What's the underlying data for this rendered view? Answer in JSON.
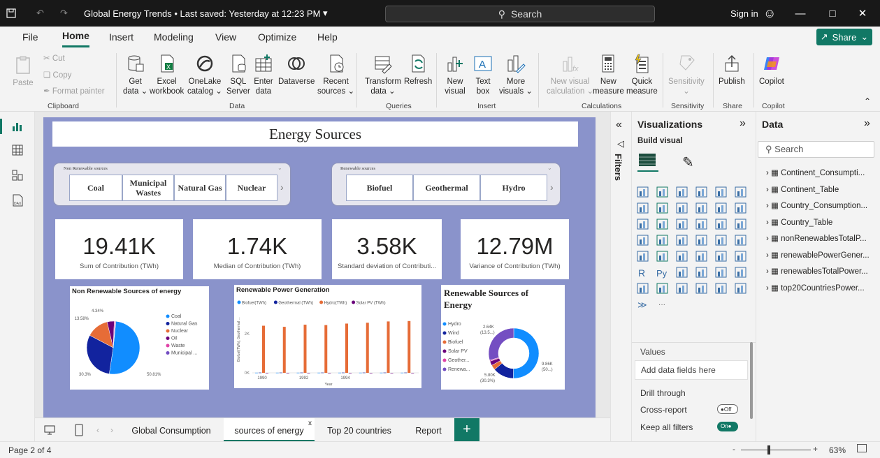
{
  "titlebar": {
    "title": "Global Energy Trends • Last saved: Yesterday at 12:23 PM",
    "search": "Search",
    "sign_in": "Sign in"
  },
  "menu": {
    "items": [
      "File",
      "Home",
      "Insert",
      "Modeling",
      "View",
      "Optimize",
      "Help"
    ],
    "share": "Share"
  },
  "ribbon": {
    "clipboard": {
      "paste": "Paste",
      "cut": "Cut",
      "copy": "Copy",
      "format_painter": "Format painter",
      "group": "Clipboard"
    },
    "data": {
      "get_data": [
        "Get",
        "data"
      ],
      "excel": [
        "Excel",
        "workbook"
      ],
      "onelake": [
        "OneLake",
        "catalog"
      ],
      "sql": [
        "SQL",
        "Server"
      ],
      "enter": [
        "Enter",
        "data"
      ],
      "dataverse": "Dataverse",
      "recent": [
        "Recent",
        "sources"
      ],
      "group": "Data"
    },
    "queries": {
      "transform": [
        "Transform",
        "data"
      ],
      "refresh": "Refresh",
      "group": "Queries"
    },
    "insert": {
      "new_visual": [
        "New",
        "visual"
      ],
      "text_box": [
        "Text",
        "box"
      ],
      "more_visuals": [
        "More",
        "visuals"
      ],
      "group": "Insert"
    },
    "calculations": {
      "new_visual_calc": [
        "New visual",
        "calculation"
      ],
      "new_measure": [
        "New",
        "measure"
      ],
      "quick_measure": [
        "Quick",
        "measure"
      ],
      "group": "Calculations"
    },
    "sensitivity": {
      "label": "Sensitivity",
      "group": "Sensitivity"
    },
    "share": {
      "publish": "Publish",
      "group": "Share"
    },
    "copilot": {
      "label": "Copilot",
      "group": "Copilot"
    }
  },
  "report": {
    "title": "Energy Sources",
    "nonrenewable_slicer": {
      "header": "Non Renewable sources",
      "items": [
        "Coal",
        "Municipal Wastes",
        "Natural Gas",
        "Nuclear"
      ]
    },
    "renewable_slicer": {
      "header": "Renewable sources",
      "items": [
        "Biofuel",
        "Geothermal",
        "Hydro"
      ]
    },
    "kpis": [
      {
        "value": "19.41K",
        "label": "Sum of Contribution (TWh)"
      },
      {
        "value": "1.74K",
        "label": "Median of Contribution (TWh)"
      },
      {
        "value": "3.58K",
        "label": "Standard deviation of Contributi..."
      },
      {
        "value": "12.79M",
        "label": "Variance of Contribution (TWh)"
      }
    ]
  },
  "chart_data": [
    {
      "type": "pie",
      "title": "Non Renewable Sources of energy",
      "labels": [
        "Coal",
        "Natural Gas",
        "Nuclear",
        "Oil",
        "Waste",
        "Municipal ..."
      ],
      "values": [
        50.81,
        30.3,
        13.58,
        4.34,
        0.6,
        0.37
      ],
      "data_labels": [
        "50.81%",
        "30.3%",
        "13.58%",
        "4.34%"
      ],
      "colors": [
        "#118dff",
        "#12239e",
        "#e66c37",
        "#6b007b",
        "#e044a7",
        "#744ec2"
      ]
    },
    {
      "type": "bar",
      "title": "Renewable Power Generation",
      "series": [
        {
          "name": "Biofuel(TWh)",
          "color": "#118dff",
          "values": [
            5,
            5,
            5,
            5,
            5,
            5,
            5,
            5
          ]
        },
        {
          "name": "Geothermal (TWh)",
          "color": "#12239e",
          "values": [
            10,
            10,
            10,
            10,
            10,
            10,
            10,
            10
          ]
        },
        {
          "name": "Hydro(TWh)",
          "color": "#e66c37",
          "values": [
            2200,
            2150,
            2250,
            2230,
            2300,
            2340,
            2400,
            2420
          ]
        },
        {
          "name": "Solar PV (TWh)",
          "color": "#6b007b",
          "values": [
            0,
            0,
            0,
            0,
            0,
            0,
            0,
            0
          ]
        }
      ],
      "x": [
        1990,
        1991,
        1992,
        1993,
        1994,
        1995,
        1996,
        1997
      ],
      "tick_labels": [
        "1990",
        "1992",
        "1994"
      ],
      "y_ticks": [
        "0K",
        "2K"
      ],
      "xlabel": "Year",
      "ylabel": "Biofuel(TWh), Geothermal ...",
      "ylim": [
        0,
        3000
      ]
    },
    {
      "type": "pie",
      "title": "Renewable Sources of Energy",
      "donut": true,
      "labels": [
        "Hydro",
        "Wind",
        "Biofuel",
        "Solar PV",
        "Geother...",
        "Renewa..."
      ],
      "values": [
        50.3,
        13.5,
        3.2,
        2.8,
        0.7,
        29.5
      ],
      "data_labels": [
        "9.86K (50...)",
        "2.64K (13.5...)",
        "5.80K (30.3%)"
      ],
      "colors": [
        "#118dff",
        "#12239e",
        "#e66c37",
        "#6b007b",
        "#e044a7",
        "#744ec2"
      ]
    }
  ],
  "filters": {
    "label": "Filters"
  },
  "viz": {
    "title": "Visualizations",
    "build": "Build visual",
    "values": "Values",
    "add_fields": "Add data fields here",
    "drill": "Drill through",
    "cross": "Cross-report",
    "cross_state": "Off",
    "keep": "Keep all filters",
    "keep_state": "On"
  },
  "data_pane": {
    "title": "Data",
    "search": "Search",
    "tables": [
      "Continent_Consumpti...",
      "Continent_Table",
      "Country_Consumption...",
      "Country_Table",
      "nonRenewablesTotalP...",
      "renewablePowerGener...",
      "renewablesTotalPower...",
      "top20CountriesPower..."
    ]
  },
  "tabs": [
    "Global Consumption",
    "sources of energy",
    "Top 20 countries",
    "Report"
  ],
  "status": {
    "page": "Page 2 of 4",
    "zoom": "63%"
  }
}
